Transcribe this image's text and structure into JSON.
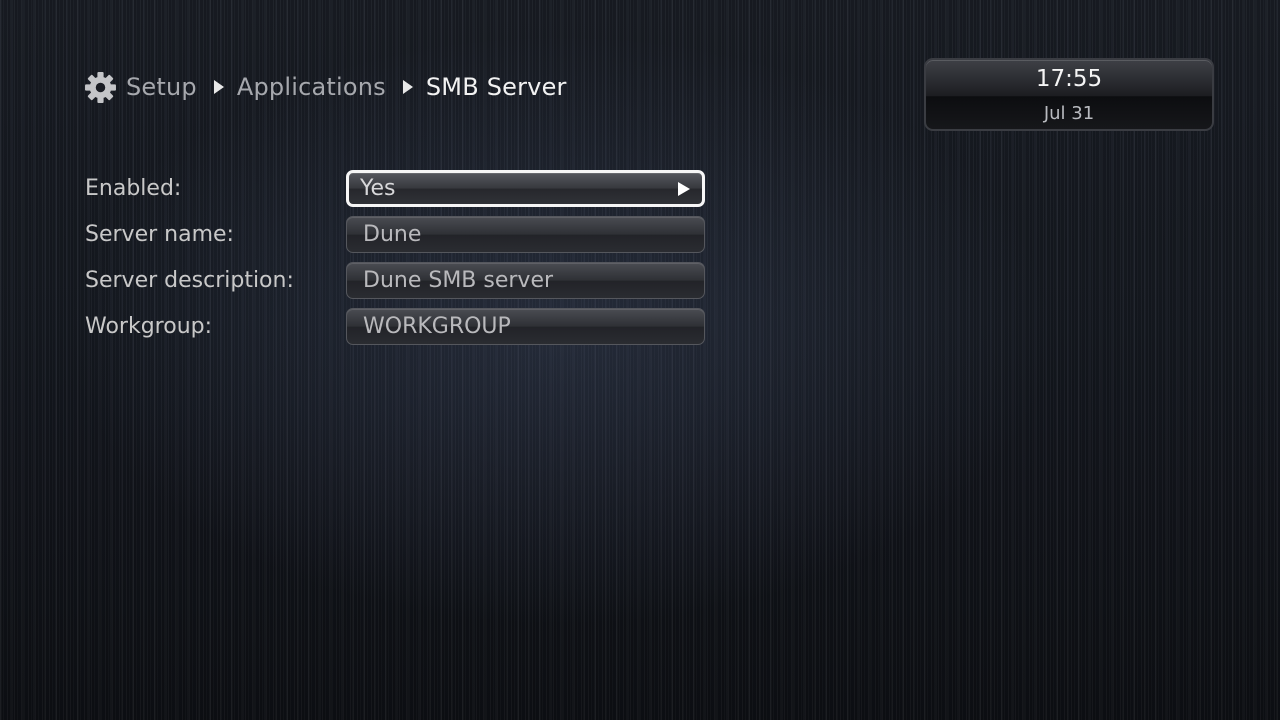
{
  "breadcrumb": {
    "icon": "gear-icon",
    "items": [
      {
        "label": "Setup"
      },
      {
        "label": "Applications"
      },
      {
        "label": "SMB Server"
      }
    ]
  },
  "clock": {
    "time": "17:55",
    "date": "Jul 31"
  },
  "settings": [
    {
      "label": "Enabled:",
      "value": "Yes",
      "focused": true
    },
    {
      "label": "Server name:",
      "value": "Dune"
    },
    {
      "label": "Server description:",
      "value": "Dune SMB server"
    },
    {
      "label": "Workgroup:",
      "value": "WORKGROUP"
    }
  ],
  "colors": {
    "focus_border": "#f6f6f6",
    "background": "#141820"
  }
}
